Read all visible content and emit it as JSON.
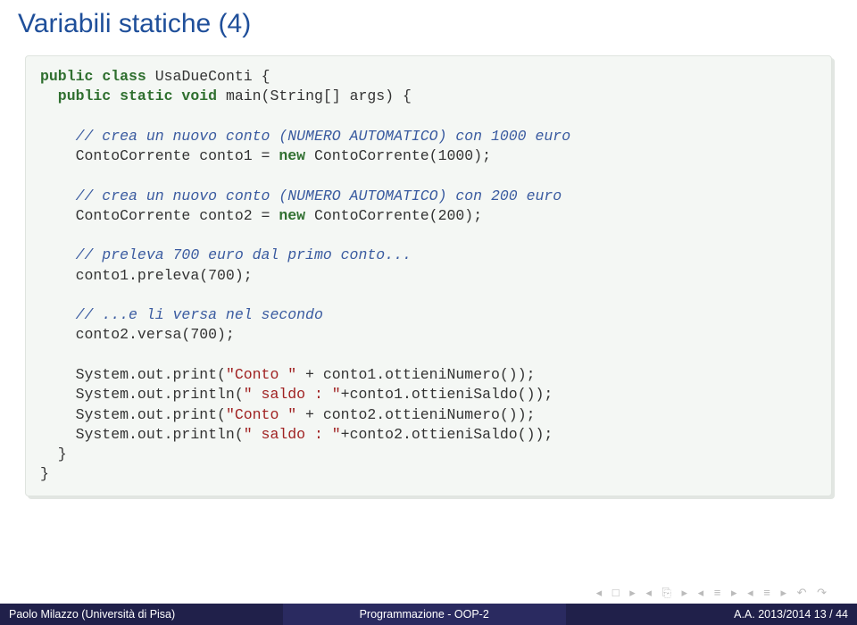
{
  "slide": {
    "title": "Variabili statiche (4)"
  },
  "code": {
    "l01a": "public",
    "l01b": " class",
    "l01c": " UsaDueConti {",
    "l02a": "  public",
    "l02b": " static",
    "l02c": " void",
    "l02d": " main(String[] args) {",
    "l03": "",
    "l04": "    // crea un nuovo conto (NUMERO AUTOMATICO) con 1000 euro",
    "l05a": "    ContoCorrente conto1 = ",
    "l05b": "new",
    "l05c": " ContoCorrente(1000);",
    "l06": "",
    "l07": "    // crea un nuovo conto (NUMERO AUTOMATICO) con 200 euro",
    "l08a": "    ContoCorrente conto2 = ",
    "l08b": "new",
    "l08c": " ContoCorrente(200);",
    "l09": "",
    "l10": "    // preleva 700 euro dal primo conto...",
    "l11": "    conto1.preleva(700);",
    "l12": "",
    "l13": "    // ...e li versa nel secondo",
    "l14": "    conto2.versa(700);",
    "l15": "",
    "l16a": "    System.out.print(",
    "l16b": "\"Conto \"",
    "l16c": " + conto1.ottieniNumero());",
    "l17a": "    System.out.println(",
    "l17b": "\" saldo : \"",
    "l17c": "+conto1.ottieniSaldo());",
    "l18a": "    System.out.print(",
    "l18b": "\"Conto \"",
    "l18c": " + conto2.ottieniNumero());",
    "l19a": "    System.out.println(",
    "l19b": "\" saldo : \"",
    "l19c": "+conto2.ottieniSaldo());",
    "l20": "  }",
    "l21": "}"
  },
  "footer": {
    "author": "Paolo Milazzo (Università di Pisa)",
    "center": "Programmazione - OOP-2",
    "right": "A.A. 2013/2014    13 / 44"
  }
}
